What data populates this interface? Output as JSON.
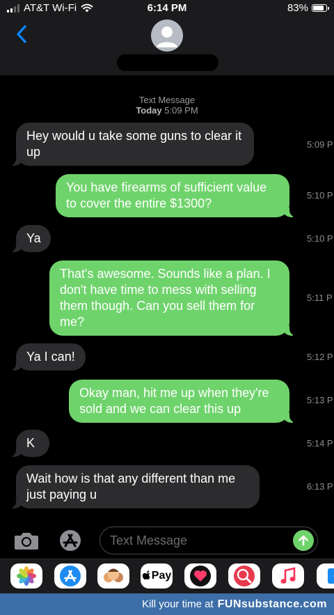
{
  "status_bar": {
    "carrier": "AT&T Wi-Fi",
    "time": "6:14 PM",
    "battery": "83%"
  },
  "header": {
    "timestamp_label": "Text Message",
    "timestamp_day": "Today",
    "timestamp_time": "5:09 PM"
  },
  "messages": [
    {
      "from": "them",
      "text": "Hey would u take some guns to clear it up",
      "time": "5:09 P"
    },
    {
      "from": "me",
      "text": "You have firearms of sufficient value to cover the entire $1300?",
      "time": "5:10 P"
    },
    {
      "from": "them",
      "text": "Ya",
      "time": "5:10 P"
    },
    {
      "from": "me",
      "text": "That's awesome. Sounds like a plan. I don't have time to mess with selling them though. Can you sell them for me?",
      "time": "5:11 P"
    },
    {
      "from": "them",
      "text": "Ya I can!",
      "time": "5:12 P"
    },
    {
      "from": "me",
      "text": "Okay man, hit me up when they're sold and we can clear this up",
      "time": "5:13 P"
    },
    {
      "from": "them",
      "text": "K",
      "time": "5:14 P"
    },
    {
      "from": "them",
      "text": "Wait how is that any different than me just paying u",
      "time": "6:13 P"
    }
  ],
  "compose": {
    "placeholder": "Text Message"
  },
  "app_drawer": [
    {
      "name": "photos-app-icon",
      "bg": "#ffffff"
    },
    {
      "name": "app-store-icon",
      "bg": "#ffffff"
    },
    {
      "name": "memoji-icon",
      "bg": "#ffffff"
    },
    {
      "name": "apple-pay-icon",
      "bg": "#ffffff",
      "label": "Pay"
    },
    {
      "name": "digital-touch-icon",
      "bg": "#ffffff"
    },
    {
      "name": "image-search-icon",
      "bg": "#ffffff"
    },
    {
      "name": "music-icon",
      "bg": "#ffffff"
    },
    {
      "name": "more-apps-icon",
      "bg": "#ffffff"
    }
  ],
  "watermark": {
    "text": "Kill your time at",
    "brand": "FUNsubstance.com"
  },
  "colors": {
    "incoming": "#2c2c2e",
    "outgoing": "#6fd36c",
    "accent": "#0a84ff"
  }
}
